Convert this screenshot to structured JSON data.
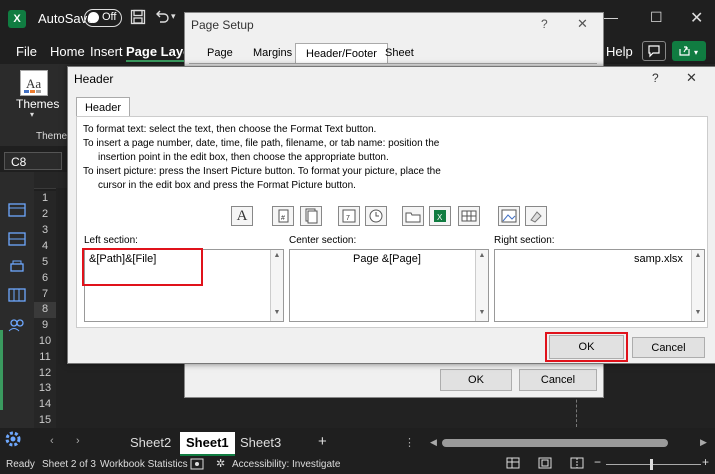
{
  "titlebar": {
    "logo": "X",
    "autosave_label": "AutoSave",
    "toggle_state": "Off",
    "icons": [
      "save-icon",
      "undo-icon",
      "dropdown-icon"
    ]
  },
  "ribbon_tabs": [
    "File",
    "Home",
    "Insert",
    "Page Layou",
    "Help"
  ],
  "ribbon": {
    "themes_button": "Themes",
    "themes_group": "Themes"
  },
  "namebox": "C8",
  "rows": [
    "1",
    "2",
    "3",
    "4",
    "5",
    "6",
    "7",
    "8",
    "9",
    "10",
    "11",
    "12",
    "13",
    "14",
    "15"
  ],
  "sheets": [
    "Sheet2",
    "Sheet1",
    "Sheet3"
  ],
  "active_sheet": "Sheet1",
  "statusbar": {
    "ready": "Ready",
    "sheet_pos": "Sheet 2 of 3",
    "stats": "Workbook Statistics",
    "accessibility": "Accessibility: Investigate"
  },
  "page_setup": {
    "title": "Page Setup",
    "tabs": [
      "Page",
      "Margins",
      "Header/Footer",
      "Sheet"
    ],
    "active_tab": "Header/Footer",
    "ok": "OK",
    "cancel": "Cancel"
  },
  "header_dialog": {
    "title": "Header",
    "tab": "Header",
    "instructions": [
      "To format text:  select the text, then choose the Format Text button.",
      "To insert a page number, date, time, file path, filename, or tab name:  position the",
      "insertion point in the edit box, then choose the appropriate button.",
      "To insert picture: press the Insert Picture button.  To format your picture, place the",
      "cursor in the edit box and press the Format Picture button."
    ],
    "format_buttons": [
      "format-text",
      "page-number",
      "number-of-pages",
      "date",
      "time",
      "file-path",
      "filename",
      "sheet-name",
      "insert-picture",
      "format-picture"
    ],
    "left_label": "Left section:",
    "center_label": "Center section:",
    "right_label": "Right section:",
    "left_value": "&[Path]&[File]",
    "center_value": "Page &[Page]",
    "right_value": "samp.xlsx",
    "ok": "OK",
    "cancel": "Cancel",
    "highlight_color": "#e0121b"
  }
}
